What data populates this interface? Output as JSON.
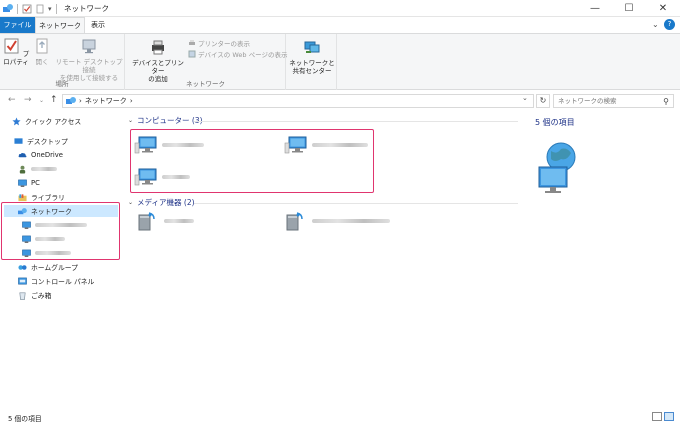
{
  "window": {
    "title": "ネットワーク",
    "controls": {
      "minimize": "—",
      "maximize": "☐",
      "close": "✕"
    }
  },
  "ribbon": {
    "tabs": {
      "file": "ファイル",
      "network": "ネットワーク",
      "view": "表示"
    },
    "groups": {
      "location": {
        "label": "場所",
        "properties": "プロパティ",
        "open": "開く",
        "remote_desktop_line1": "リモート デスクトップ接続",
        "remote_desktop_line2": "を使用して接続する"
      },
      "network": {
        "label": "ネットワーク",
        "add_devices_line1": "デバイスとプリンター",
        "add_devices_line2": "の追加",
        "show_printers": "プリンターの表示",
        "show_device_web": "デバイスの Web ページの表示"
      },
      "center": {
        "line1": "ネットワークと",
        "line2": "共有センター"
      }
    }
  },
  "address": {
    "sep1": "›",
    "path": "ネットワーク",
    "sep2": "›",
    "search_placeholder": "ネットワークの検索"
  },
  "navigation": {
    "quick_access": "クイック アクセス",
    "desktop": "デスクトップ",
    "onedrive": "OneDrive",
    "pc": "PC",
    "libraries": "ライブラリ",
    "network": "ネットワーク",
    "homegroup": "ホームグループ",
    "control_panel": "コントロール パネル",
    "recycle_bin": "ごみ箱"
  },
  "content": {
    "computers_header": "コンピューター (3)",
    "media_header": "メディア機器 (2)"
  },
  "details": {
    "count": "5 個の項目"
  },
  "status": {
    "text": "5 個の項目"
  },
  "colors": {
    "accent": "#1979ca",
    "highlight": "#e0356f",
    "group_header": "#1e3287",
    "selected": "#cce8ff"
  }
}
